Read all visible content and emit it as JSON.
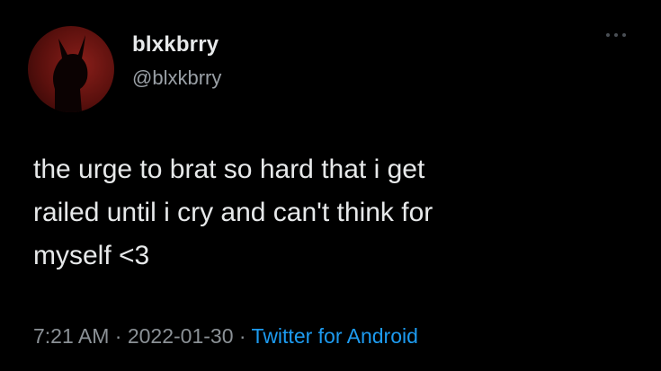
{
  "author": {
    "display_name": "blxkbrry",
    "handle": "@blxkbrry"
  },
  "tweet": {
    "text": "the urge to brat so hard that i get\nrailed until i cry and can't think for\nmyself <3",
    "time": "7:21 AM",
    "separator": "·",
    "date": "2022-01-30",
    "source": "Twitter for Android"
  },
  "icons": {
    "more": "more-horizontal-icon",
    "avatar": "avatar-silhouette"
  },
  "colors": {
    "background": "#000000",
    "text": "#e7e9ea",
    "secondary": "#8b9196",
    "link": "#1d9bf0",
    "avatar_red": "#8a1f1a"
  }
}
